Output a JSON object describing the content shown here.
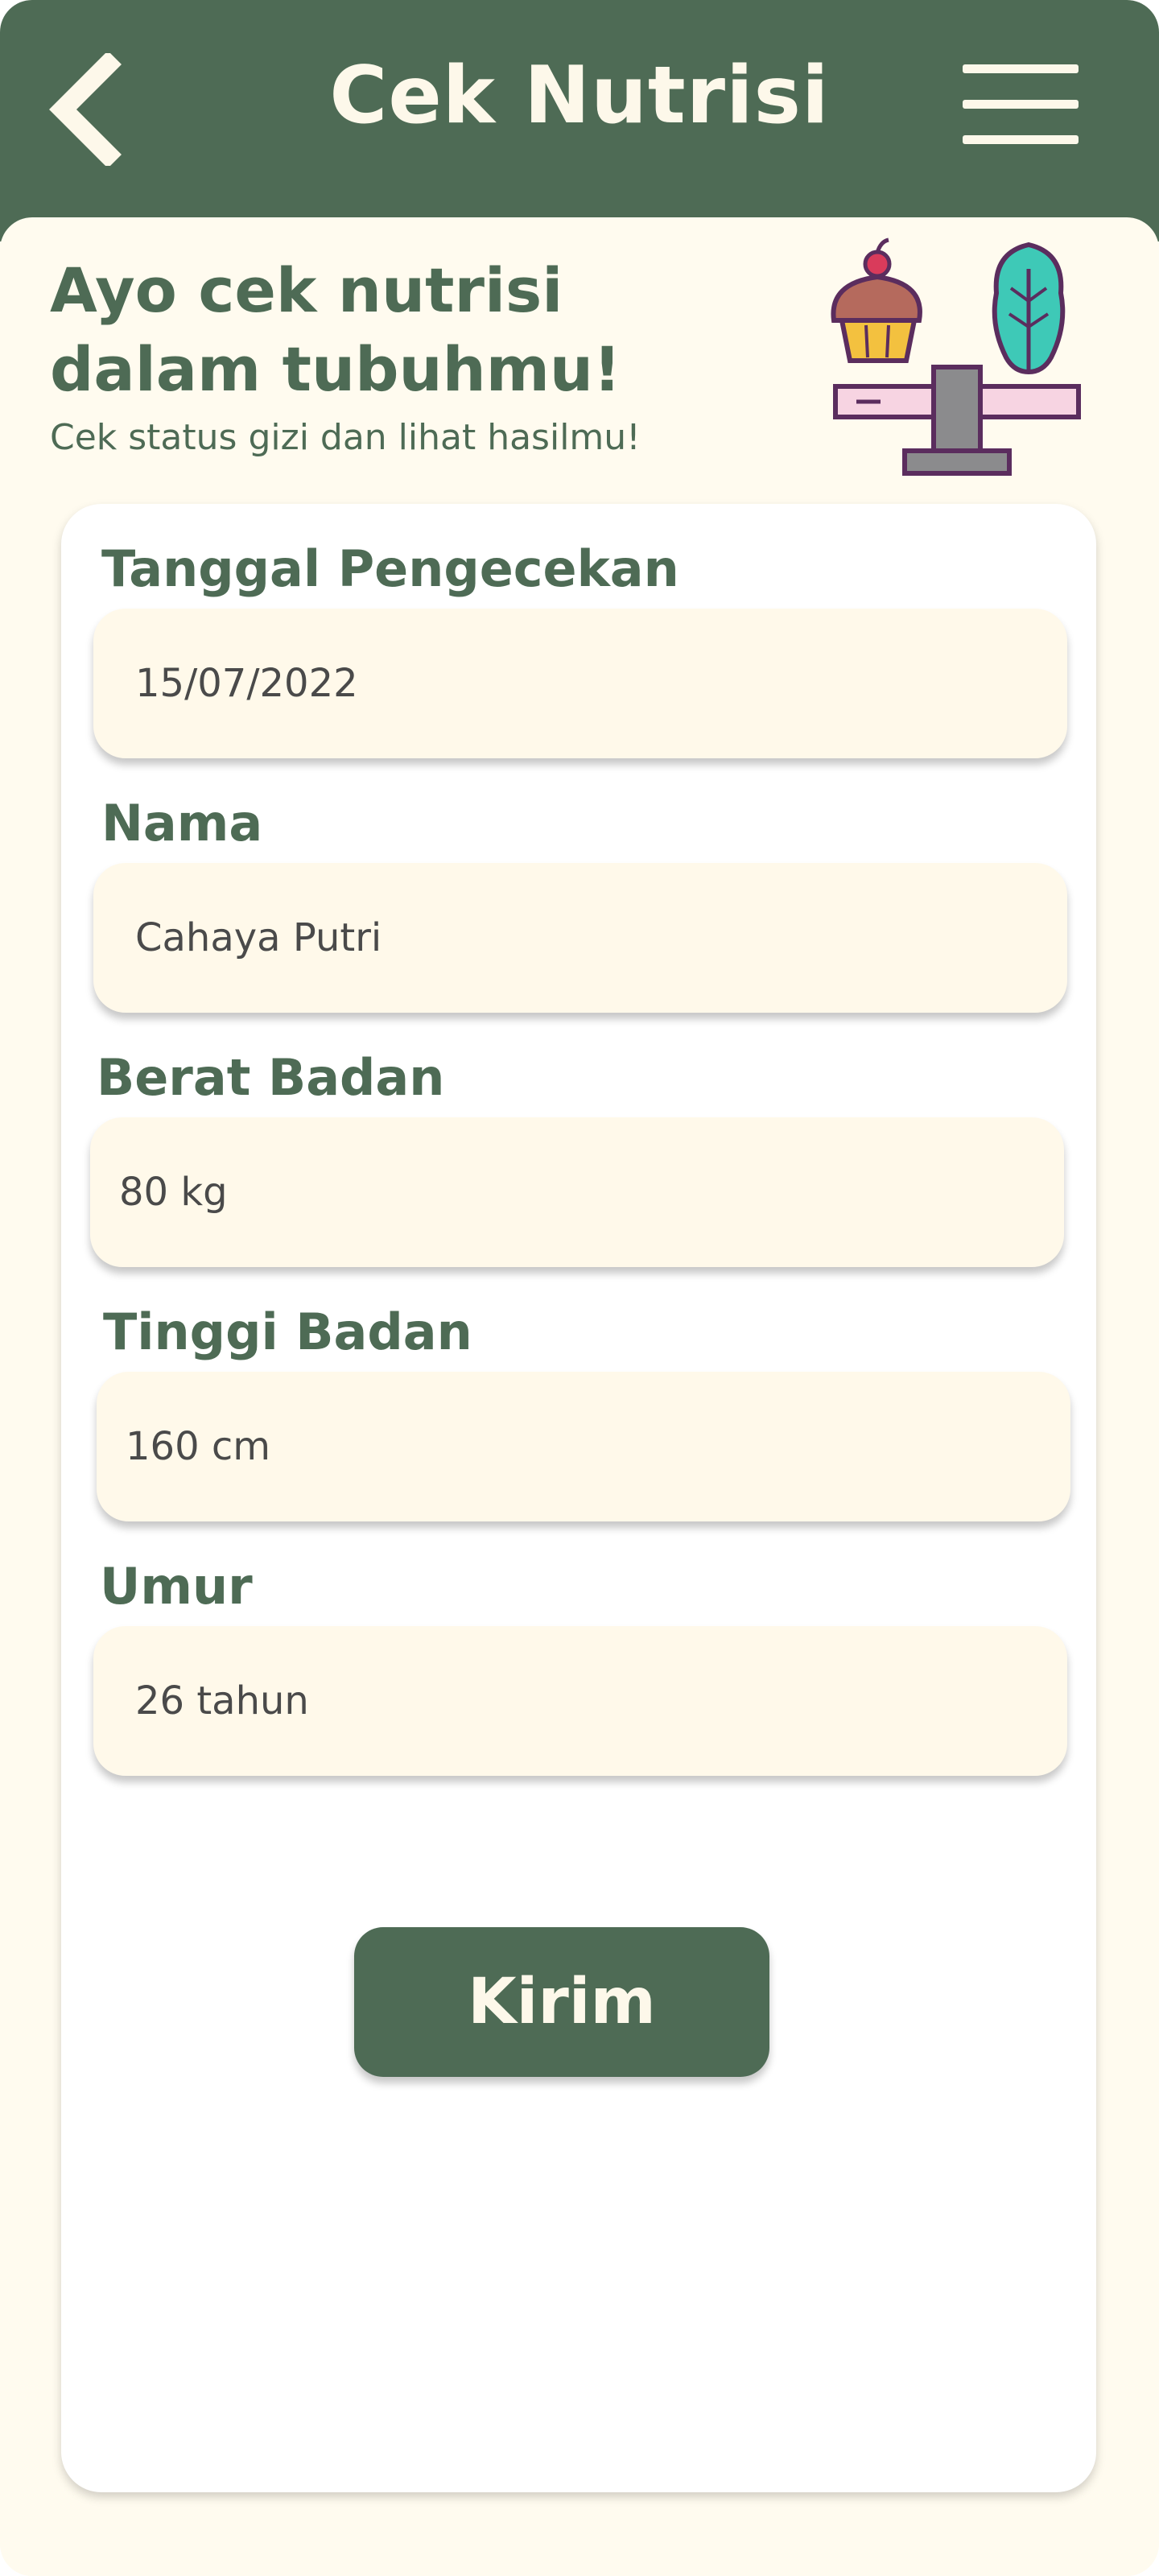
{
  "header": {
    "title": "Cek Nutrisi",
    "back_icon": "chevron-left-icon",
    "menu_icon": "hamburger-menu-icon"
  },
  "intro": {
    "heading": "Ayo cek nutrisi dalam tubuhmu!",
    "subheading": "Cek status gizi dan lihat hasilmu!",
    "illustration": "cupcake-vegetable-scale-icon"
  },
  "form": {
    "date": {
      "label": "Tanggal Pengecekan",
      "value": "15/07/2022"
    },
    "name": {
      "label": "Nama",
      "value": "Cahaya Putri"
    },
    "weight": {
      "label": "Berat Badan",
      "value": "80 kg"
    },
    "height": {
      "label": "Tinggi Badan",
      "value": "160 cm"
    },
    "age": {
      "label": "Umur",
      "value": "26 tahun"
    },
    "submit_label": "Kirim"
  },
  "colors": {
    "primary": "#4e6b55",
    "background": "#fffbef",
    "field": "#fff9ea",
    "text_light": "#fdf8ea"
  }
}
